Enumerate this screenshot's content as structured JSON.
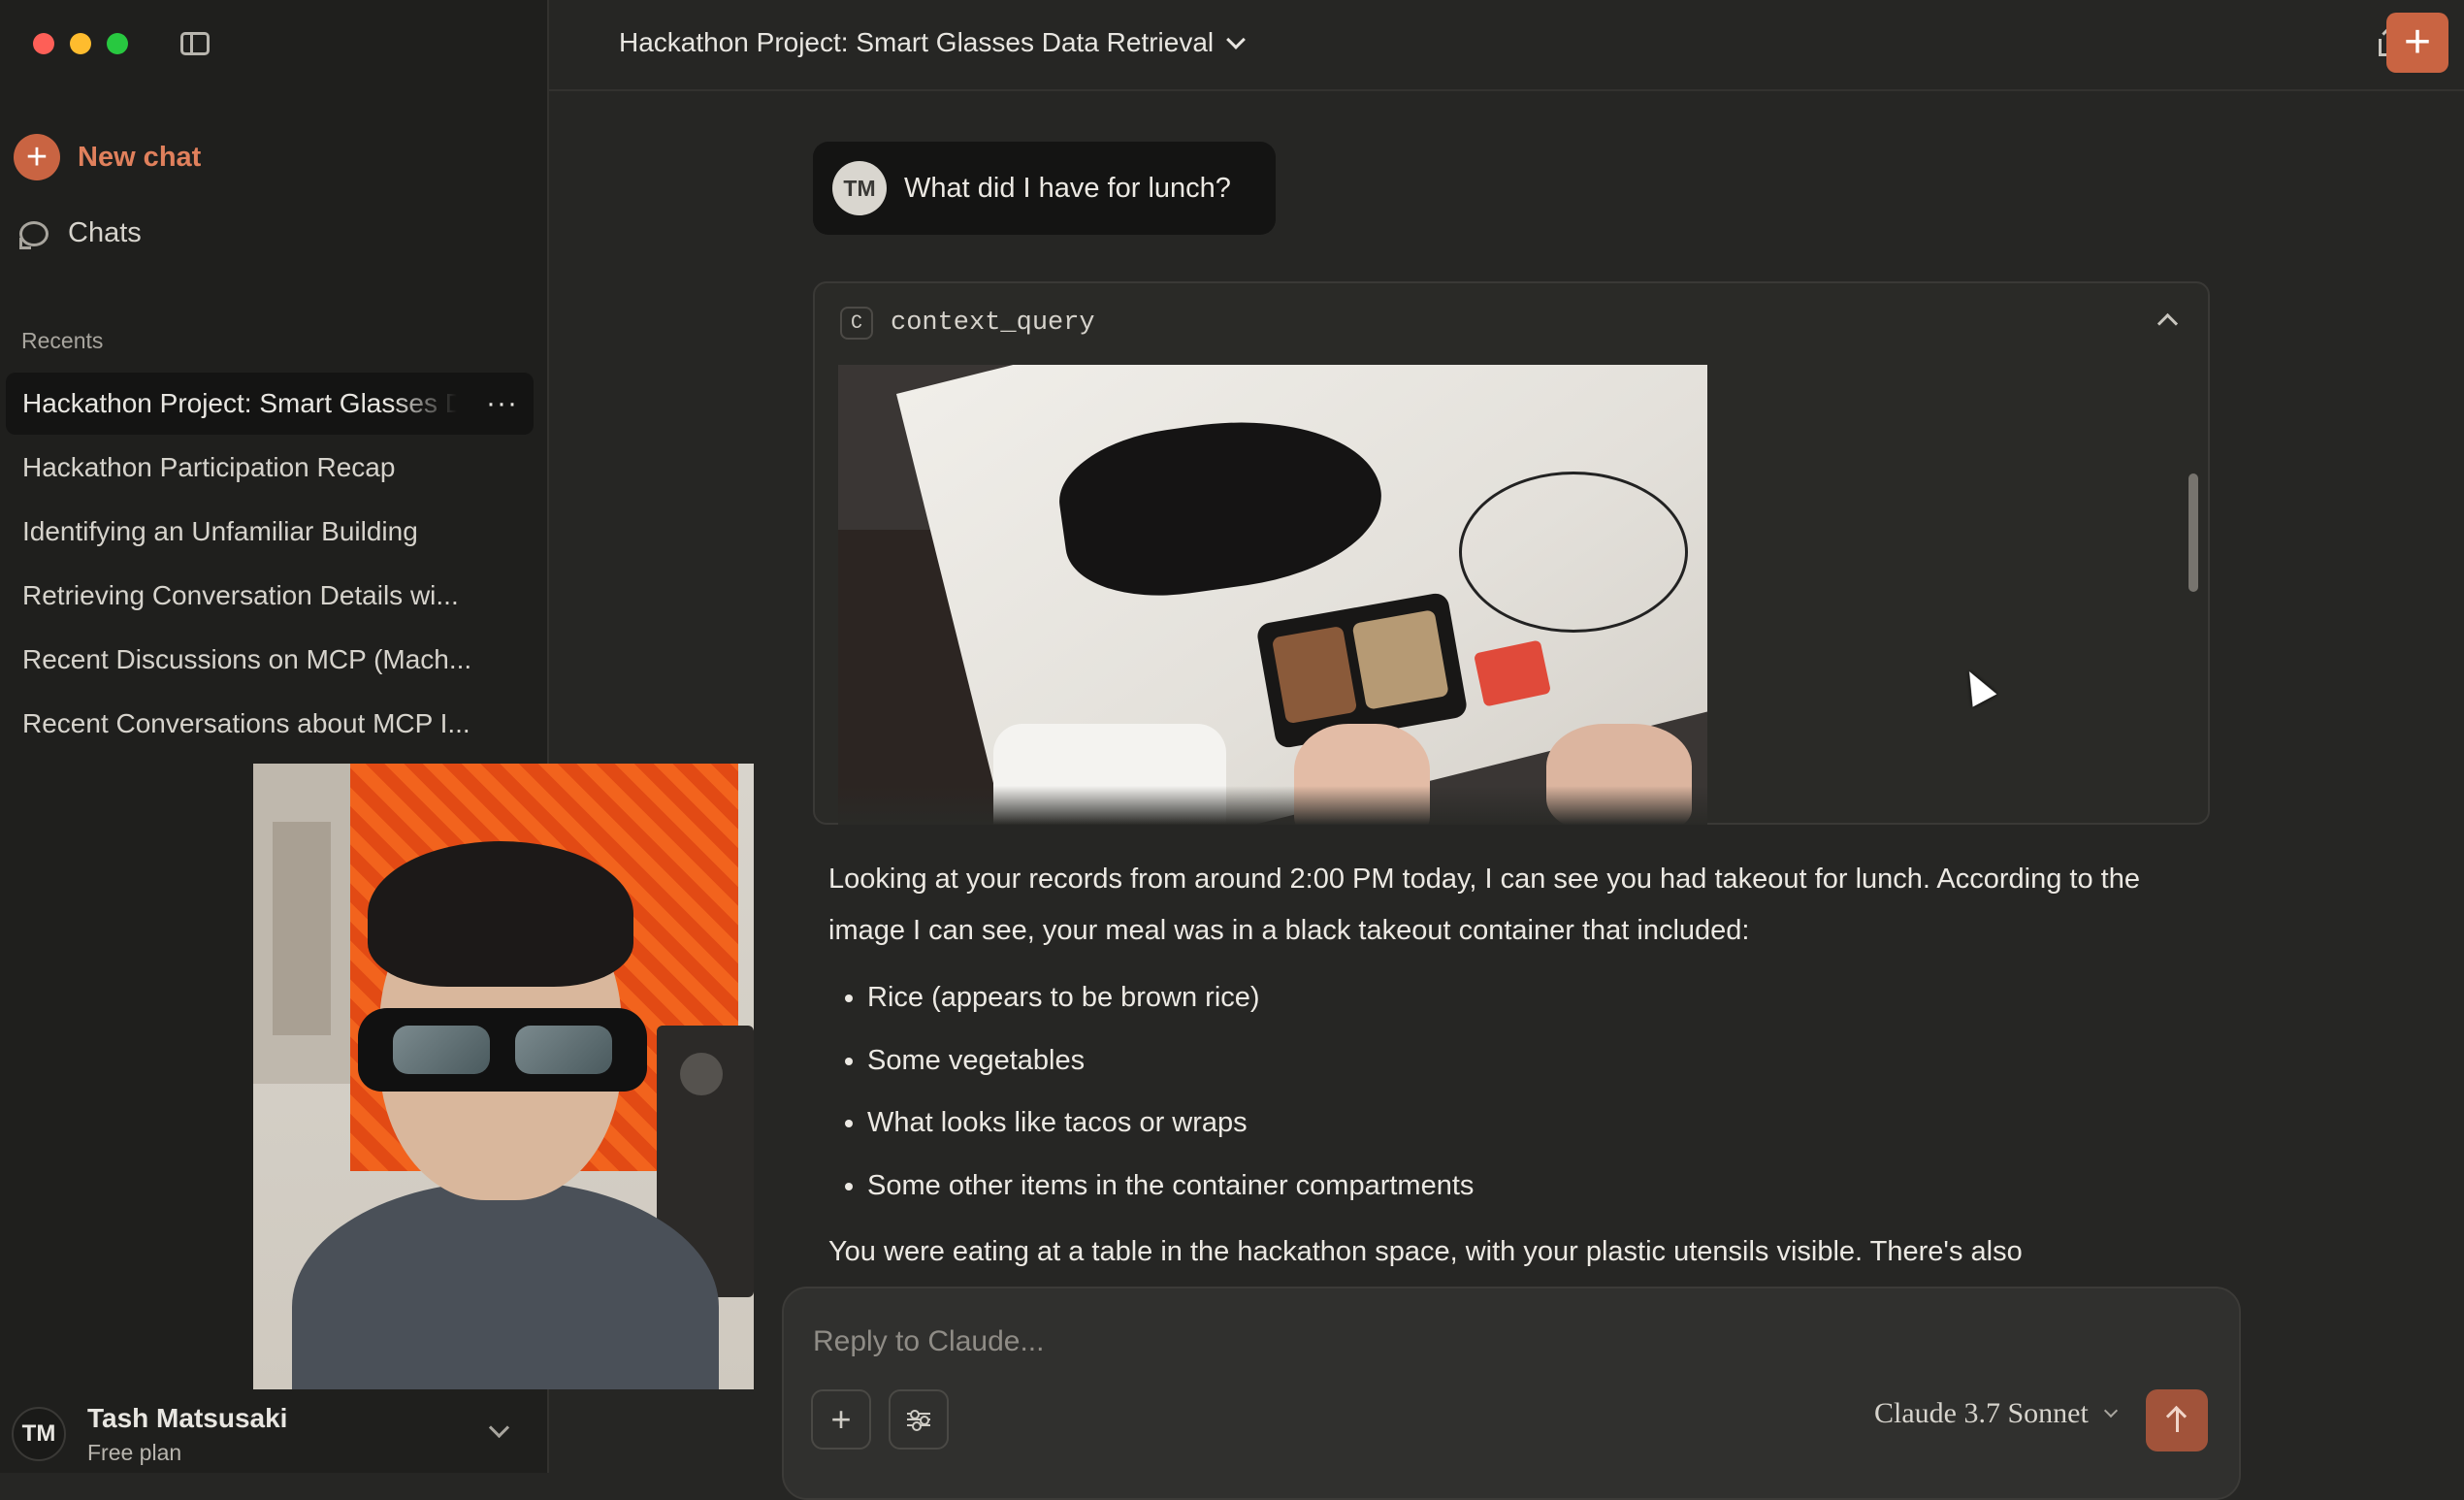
{
  "sidebar": {
    "new_chat_label": "New chat",
    "chats_label": "Chats",
    "recents_label": "Recents",
    "recents": [
      {
        "label": "Hackathon Project: Smart Glasses Data Retrieval",
        "active": true
      },
      {
        "label": "Hackathon Participation Recap"
      },
      {
        "label": "Identifying an Unfamiliar Building"
      },
      {
        "label": "Retrieving Conversation Details wi..."
      },
      {
        "label": "Recent Discussions on MCP (Mach..."
      },
      {
        "label": "Recent Conversations about MCP I..."
      }
    ],
    "more_label": "···",
    "user": {
      "initials": "TM",
      "name": "Tash Matsusaki",
      "plan": "Free plan"
    }
  },
  "header": {
    "title": "Hackathon Project: Smart Glasses Data Retrieval",
    "add_label": "+"
  },
  "conversation": {
    "user_message": {
      "initials": "TM",
      "text": "What did I have for lunch?"
    },
    "tool": {
      "badge": "C",
      "name": "context_query"
    },
    "reply": {
      "para1": "Looking at your records from around 2:00 PM today, I can see you had takeout for lunch. According to the image I can see, your meal was in a black takeout container that included:",
      "items": [
        "Rice (appears to be brown rice)",
        "Some vegetables",
        "What looks like tacos or wraps",
        "Some other items in the container compartments"
      ],
      "para2": "You were eating at a table in the hackathon space, with your plastic utensils visible. There's also"
    }
  },
  "composer": {
    "placeholder": "Reply to Claude...",
    "attach_label": "+",
    "model": "Claude 3.7 Sonnet"
  },
  "colors": {
    "accent": "#c96442",
    "background": "#262624",
    "sidebar": "#1f1f1d"
  }
}
